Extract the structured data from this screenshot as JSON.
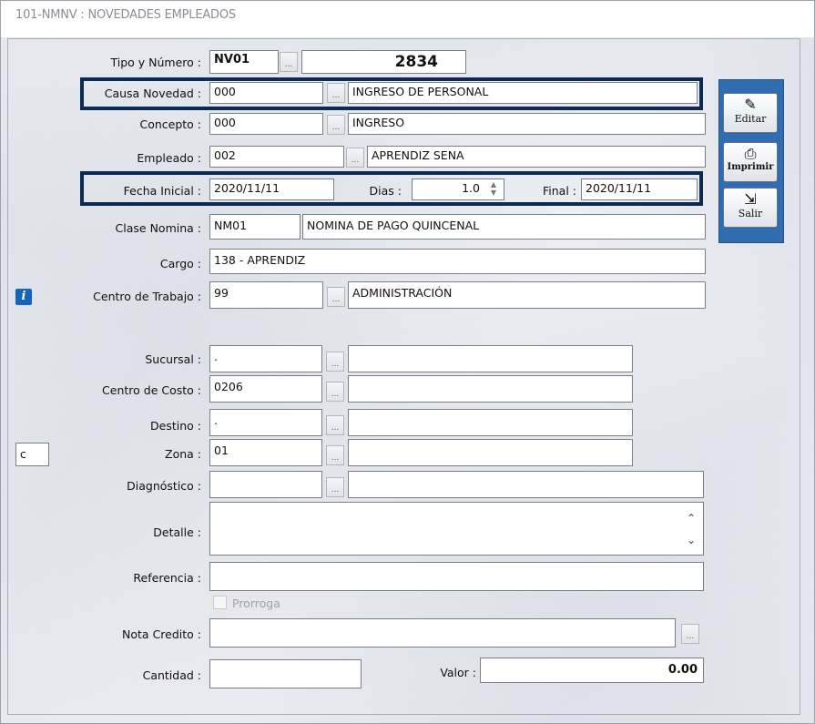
{
  "window": {
    "title": "101-NMNV : NOVEDADES EMPLEADOS"
  },
  "tipo_numero": {
    "label": "Tipo y Número :",
    "tipo": "NV01",
    "numero": "2834"
  },
  "causa_novedad": {
    "label": "Causa Novedad :",
    "code": "000",
    "desc": "INGRESO DE PERSONAL"
  },
  "concepto": {
    "label": "Concepto :",
    "code": "000",
    "desc": "INGRESO"
  },
  "empleado": {
    "label": "Empleado :",
    "code": "002",
    "desc": "APRENDIZ SENA"
  },
  "fechas": {
    "inicial_label": "Fecha Inicial :",
    "inicial": "2020/11/11",
    "dias_label": "Dias :",
    "dias": "1.0",
    "final_label": "Final :",
    "final": "2020/11/11"
  },
  "clase_nomina": {
    "label": "Clase Nomina :",
    "code": "NM01",
    "desc": "NOMINA DE PAGO QUINCENAL"
  },
  "cargo": {
    "label": "Cargo :",
    "value": "138 - APRENDIZ"
  },
  "centro_trabajo": {
    "label": "Centro de Trabajo :",
    "code": "99",
    "desc": "ADMINISTRACIÓN"
  },
  "sucursal": {
    "label": "Sucursal :",
    "code": ".",
    "desc": ""
  },
  "centro_costo": {
    "label": "Centro de Costo :",
    "code": "0206",
    "desc": ""
  },
  "destino": {
    "label": "Destino :",
    "code": ".",
    "desc": ""
  },
  "zona": {
    "label": "Zona :",
    "code": "01",
    "desc": ""
  },
  "side_field": {
    "value": "c"
  },
  "diagnostico": {
    "label": "Diagnóstico :",
    "code": "",
    "desc": ""
  },
  "detalle": {
    "label": "Detalle :",
    "value": ""
  },
  "referencia": {
    "label": "Referencia :",
    "value": ""
  },
  "prorroga": {
    "label": "Prorroga",
    "checked": false
  },
  "nota_credito": {
    "label": "Nota Credito :",
    "value": ""
  },
  "cantidad": {
    "label": "Cantidad :",
    "value": ""
  },
  "valor": {
    "label": "Valor :",
    "value": "0.00"
  },
  "actions": {
    "editar": "Editar",
    "imprimir": "Imprimir",
    "salir": "Salir"
  },
  "ellipsis": "..."
}
